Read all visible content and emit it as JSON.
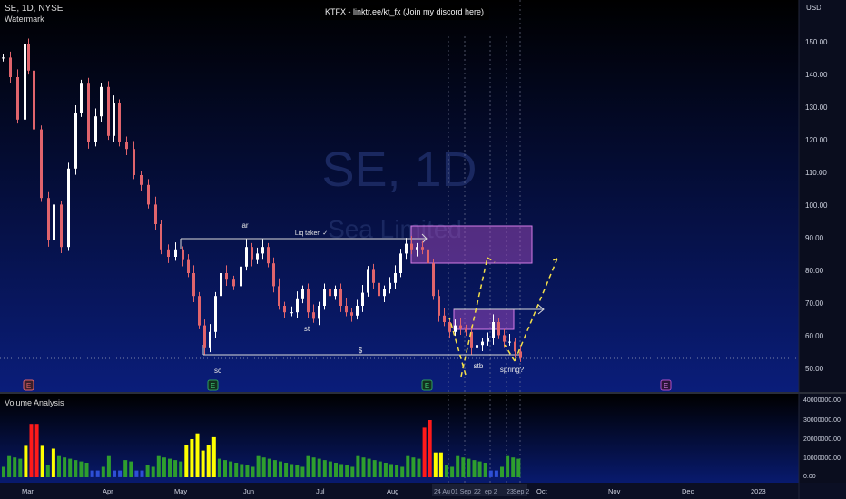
{
  "header": {
    "symbol": "SE, 1D, NYSE",
    "indicator": "Watermark",
    "banner": "KTFX - linktr.ee/kt_fx (Join my discord here)"
  },
  "currency": "USD",
  "watermark": {
    "ticker": "SE, 1D",
    "company": "Sea Limited"
  },
  "annotations": {
    "ar": "ar",
    "liq": "Liq taken ✓",
    "st": "st",
    "dollar": "$",
    "sc": "sc",
    "stb": "stb",
    "spring": "spring?"
  },
  "price_axis": [
    "150.00",
    "140.00",
    "130.00",
    "120.00",
    "110.00",
    "100.00",
    "90.00",
    "80.00",
    "70.00",
    "60.00",
    "50.00"
  ],
  "volume_axis": [
    "40000000.00",
    "30000000.00",
    "20000000.00",
    "10000000.00",
    "0.00"
  ],
  "time_axis": [
    "Mar",
    "Apr",
    "May",
    "Jun",
    "Jul",
    "Aug",
    "Oct",
    "Nov",
    "Dec",
    "2023"
  ],
  "date_markers": [
    "24 Au",
    "01 Sep",
    "22",
    "ep 2",
    "23",
    "Sep 2"
  ],
  "volume_panel": {
    "title": "Volume Analysis"
  },
  "event_markers": [
    "E",
    "E",
    "E",
    "E"
  ],
  "colors": {
    "up": "#ffffff",
    "down": "#e0646c",
    "volume_normal": "#2e9e2e",
    "volume_high": "#ffff00",
    "volume_climax": "#ff1a1a",
    "volume_low": "#2e4fd6",
    "zone": "#b14fc8",
    "projection": "#f5e04a",
    "background_top": "#000000",
    "background_bottom": "#0a1d7a"
  }
}
